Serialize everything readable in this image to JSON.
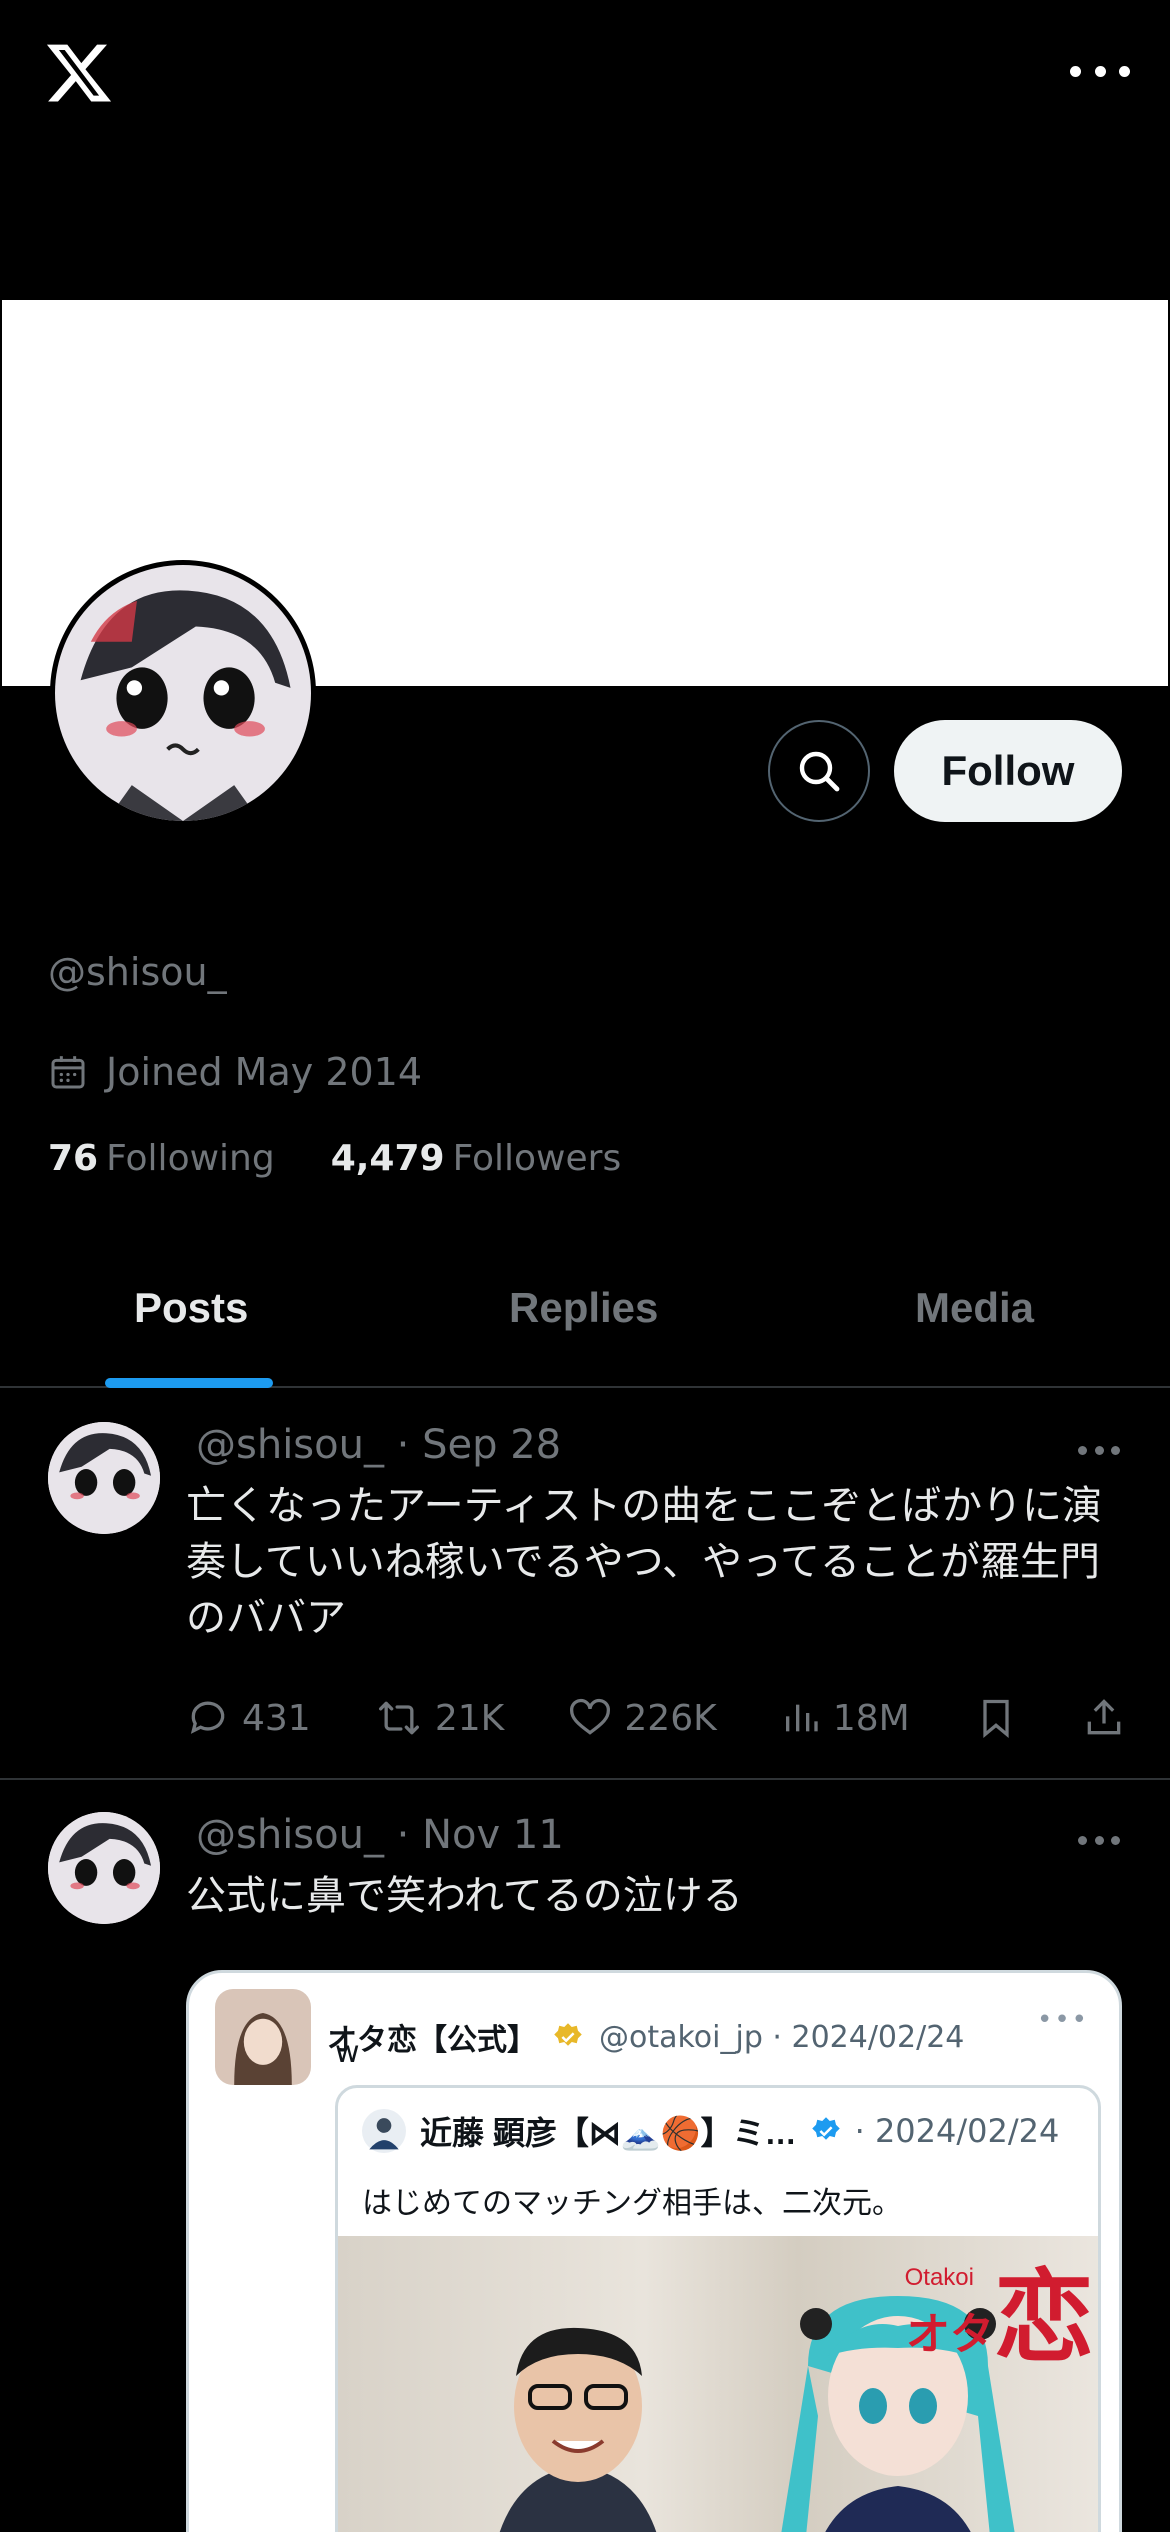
{
  "app": {
    "name": "X"
  },
  "profile": {
    "handle": "@shisou_",
    "joined": "Joined May 2014",
    "following_count": "76",
    "following_label": "Following",
    "followers_count": "4,479",
    "followers_label": "Followers",
    "follow_label": "Follow"
  },
  "tabs": [
    {
      "label": "Posts"
    },
    {
      "label": "Replies"
    },
    {
      "label": "Media"
    }
  ],
  "posts": [
    {
      "meta": "@shisou_ · Sep 28",
      "text": "亡くなったアーティストの曲をここぞとばかりに演奏していいね稼いでるやつ、やってることが羅生門のババア",
      "replies": "431",
      "reposts": "21K",
      "likes": "226K",
      "views": "18M"
    },
    {
      "meta": "@shisou_ · Nov 11",
      "text": "公式に鼻で笑われてるの泣ける",
      "quote": {
        "name": "オタ恋【公式】",
        "handle_date": "@otakoi_jp · 2024/02/24",
        "text": "w",
        "inner": {
          "name": "近藤 顕彦【⋈🗻🏀】ミ…",
          "date": "· 2024/02/24",
          "text": "はじめてのマッチング相手は、二次元。",
          "image_sub": "Otakoi",
          "image_kana": "オタ",
          "image_kanji": "恋"
        }
      }
    }
  ],
  "colors": {
    "accent": "#1d9bf0",
    "muted": "#71767b",
    "divider": "#2f3336",
    "verified_gold": "#e8b829",
    "verified_blue": "#1d9bf0"
  }
}
